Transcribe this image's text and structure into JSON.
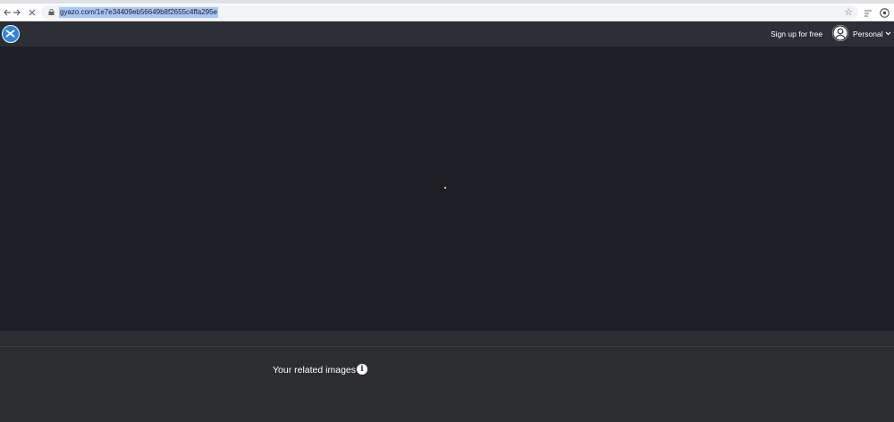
{
  "browser": {
    "url": "gyazo.com/1e7e34409eb56649b8f2655c4ffa295e",
    "back_icon": "arrow-left",
    "forward_icon": "arrow-right",
    "stop_icon": "close",
    "star_icon": "bookmark-star",
    "selection_color": "#a8c7fa"
  },
  "header": {
    "logo_icon": "gyazo-logo",
    "signup_label": "Sign up for free",
    "account_label": "Personal",
    "brand_color": "#2f86d8"
  },
  "related": {
    "title": "Your related images",
    "info_icon_glyph": "i"
  }
}
